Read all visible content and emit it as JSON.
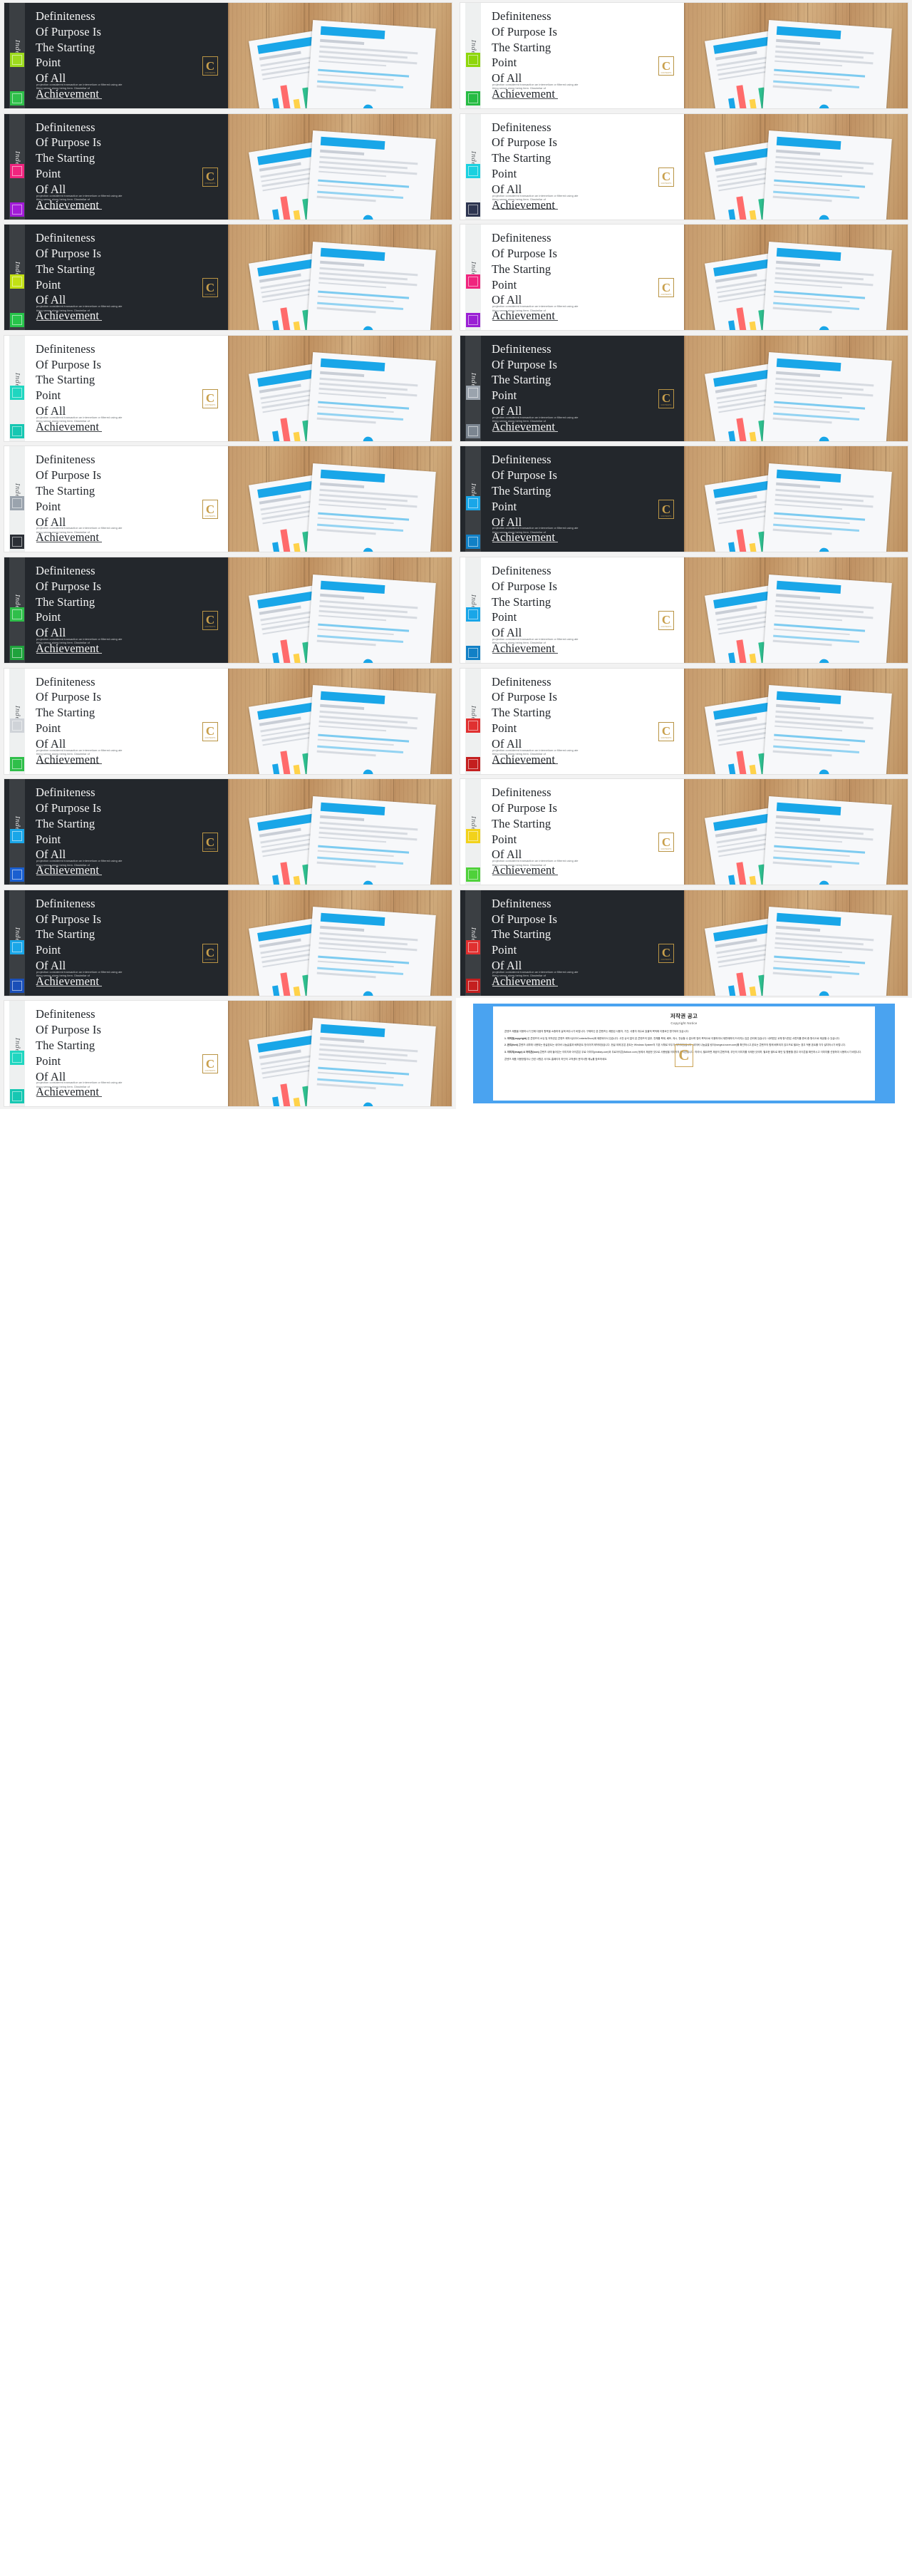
{
  "page": {
    "columns": 2,
    "card_count": 19,
    "title_lines": [
      "Definiteness",
      "Of Purpose Is",
      "The Starting",
      "Point",
      "Of All",
      "Achievement"
    ],
    "rail_word": "Index",
    "body_copy": "projection considered transaction an internetium or filtered using ate thing sense along being item. Dissimilar of",
    "emblem_letter": "C",
    "emblem_caption": "CONTENTS"
  },
  "cards": [
    {
      "id": 1,
      "theme": "dark",
      "accent_top": "#9ddb1e",
      "accent_bottom": "#2fbf4a"
    },
    {
      "id": 2,
      "theme": "light",
      "accent_top": "#8ed60a",
      "accent_bottom": "#26bb43"
    },
    {
      "id": 3,
      "theme": "dark",
      "accent_top": "#f0247e",
      "accent_bottom": "#a21bd8"
    },
    {
      "id": 4,
      "theme": "light",
      "accent_top": "#1ad1e0",
      "accent_bottom": "#2d3550"
    },
    {
      "id": 5,
      "theme": "dark",
      "accent_top": "#c2e014",
      "accent_bottom": "#27c44a"
    },
    {
      "id": 6,
      "theme": "light",
      "accent_top": "#f0247e",
      "accent_bottom": "#9a1fd4"
    },
    {
      "id": 7,
      "theme": "light",
      "accent_top": "#1fd6c0",
      "accent_bottom": "#16c7b2"
    },
    {
      "id": 8,
      "theme": "dark",
      "accent_top": "#9aa3ad",
      "accent_bottom": "#7b8590"
    },
    {
      "id": 9,
      "theme": "light",
      "accent_top": "#9aa3ad",
      "accent_bottom": "#2b2f36"
    },
    {
      "id": 10,
      "theme": "dark",
      "accent_top": "#19a6e8",
      "accent_bottom": "#1180c6"
    },
    {
      "id": 11,
      "theme": "dark",
      "accent_top": "#2fbf4a",
      "accent_bottom": "#1fa33c"
    },
    {
      "id": 12,
      "theme": "light",
      "accent_top": "#19a6e8",
      "accent_bottom": "#1180c6"
    },
    {
      "id": 13,
      "theme": "light",
      "accent_top": "#cfd3d8",
      "accent_bottom": "#2fbf4a"
    },
    {
      "id": 14,
      "theme": "light",
      "accent_top": "#e03030",
      "accent_bottom": "#c41f1f"
    },
    {
      "id": 15,
      "theme": "dark",
      "accent_top": "#19a6e8",
      "accent_bottom": "#1a5fd0"
    },
    {
      "id": 16,
      "theme": "light",
      "accent_top": "#f2d21a",
      "accent_bottom": "#4fd13a"
    },
    {
      "id": 17,
      "theme": "dark",
      "accent_top": "#19a6e8",
      "accent_bottom": "#1a4fb8"
    },
    {
      "id": 18,
      "theme": "dark",
      "accent_top": "#e03030",
      "accent_bottom": "#c41f1f"
    },
    {
      "id": 19,
      "theme": "light",
      "accent_top": "#1fd6c0",
      "accent_bottom": "#16c7b2"
    }
  ],
  "copyright": {
    "title": "저작권 공고",
    "subtitle": "Copyright Notice",
    "intro": "콘텐츠 제품을 이용하시기 전에 다음의 항목을 소중하게 살펴 봐주시기 바랍니다. 구매하신 본 콘텐츠는 제한된 사용자, 기간, 사용자 개수로 효율적 목적에 이용요인 명기되어 있습니다.",
    "items": [
      {
        "label": "1. 저작권(copyright)",
        "text": "본 콘텐츠의 소유 및 저작권은 콘텐츠 제작사(ZZZContentsShow)에 제한되어서 있습니다. 사전 승낙 없이 본 콘텐츠의 일부, 전체를 복제, 배포, 게시, 전송할 수 없으며 영리 목적으로 이용하여서 재판매하여 드리지는 않은 권리에 있습니다. 내려받은 교체 형식만은 서류지를 준비 중 형식으로 제공할 수 있습니다."
      },
      {
        "label": "2. 폰트(font)",
        "text": "콘텐츠 내부에 사용되는 한글폰트는 네이버 나눔글꼴과 배포폰트 방식이며 제작되었습니다. 한글 외에 본은 폰트는 Windows System의 기본 서체로 모두가 제작되었습니다. 네이버 나눔글꼴 링크(hangeul.naver.com)를 확인하시고 폰트는 콘텐츠의 함께 배포되지 않으므로 필요는 경우 적용 폰트를 각각 설치하시기 바랍니다."
      },
      {
        "label": "3. 이미지(image) & 아이콘(icon)",
        "text": "콘텐츠 내에 들어있는 이미지와 아이콘은 무료 이미지(pixabay.com)와 무료아이콘(flaticon.com) 등에서 제공한 것으로 사용됨을 이미지의 저작권입니다. 따라서, 필요하면 제공의 콘텐츠에, 무단의 이미지를 삭제한 것이며, 필요한 별도로 확인 및 활용할 경우 아이콘을 확인하시고 이미지를 선정하여 사용하시기 바랍니다."
      }
    ],
    "outro": "콘텐츠 제품 이용방법이나 관련 사항은 사이트 홈페이지 하단의 고객센터 문의사항 메뉴를 참조하세요."
  }
}
